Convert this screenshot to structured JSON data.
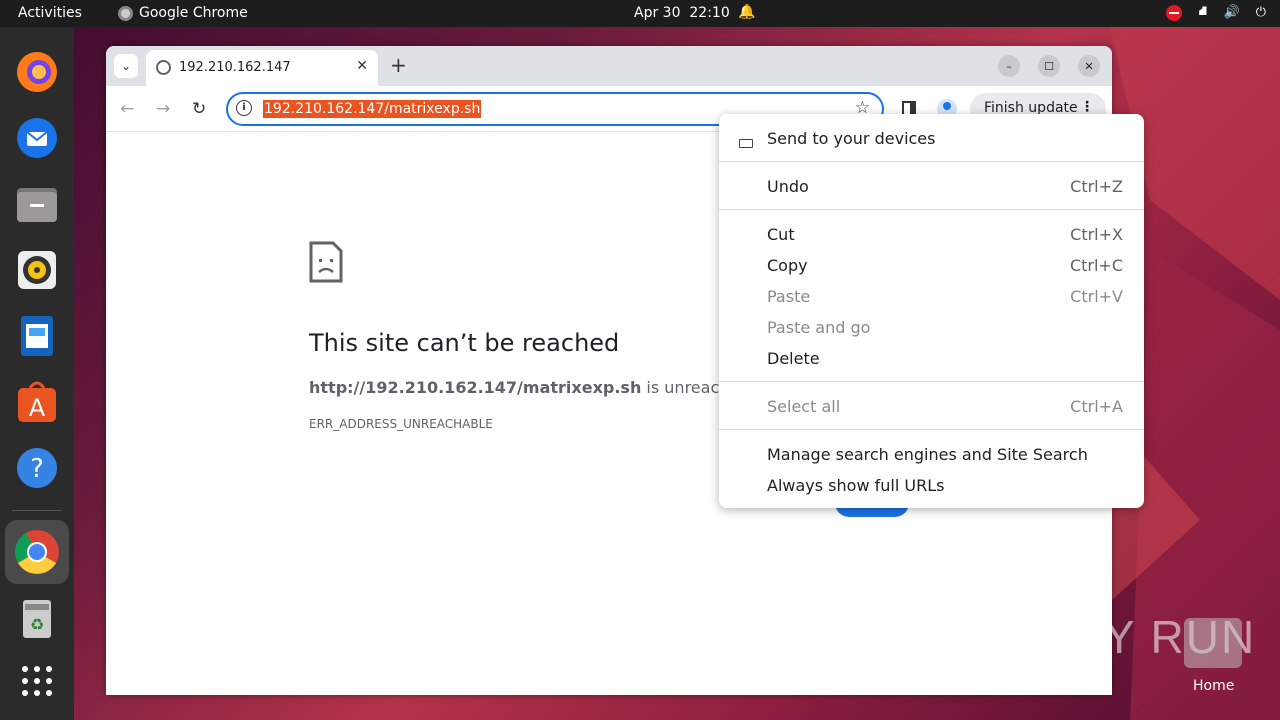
{
  "topbar": {
    "activities": "Activities",
    "app_name": "Google Chrome",
    "date": "Apr 30",
    "time": "22:10"
  },
  "dock": {
    "items": [
      "firefox",
      "thunderbird",
      "files",
      "rhythmbox",
      "libreoffice-writer",
      "app-center",
      "help",
      "google-chrome",
      "trash",
      "show-apps"
    ]
  },
  "browser": {
    "tab_title": "192.210.162.147",
    "address": "192.210.162.147/matrixexp.sh",
    "finish_update": "Finish update"
  },
  "error_page": {
    "title": "This site can’t be reached",
    "url_bold": "http://192.210.162.147/matrixexp.sh",
    "url_suffix": " is unreachab",
    "error_code": "ERR_ADDRESS_UNREACHABLE"
  },
  "context_menu": {
    "send": "Send to your devices",
    "undo": {
      "label": "Undo",
      "shortcut": "Ctrl+Z"
    },
    "cut": {
      "label": "Cut",
      "shortcut": "Ctrl+X"
    },
    "copy": {
      "label": "Copy",
      "shortcut": "Ctrl+C"
    },
    "paste": {
      "label": "Paste",
      "shortcut": "Ctrl+V"
    },
    "paste_go": {
      "label": "Paste and go"
    },
    "delete": {
      "label": "Delete"
    },
    "select_all": {
      "label": "Select all",
      "shortcut": "Ctrl+A"
    },
    "manage": {
      "label": "Manage search engines and Site Search"
    },
    "full_urls": {
      "label": "Always show full URLs"
    }
  },
  "desktop": {
    "home_label": "Home",
    "watermark": "ANY RUN"
  }
}
